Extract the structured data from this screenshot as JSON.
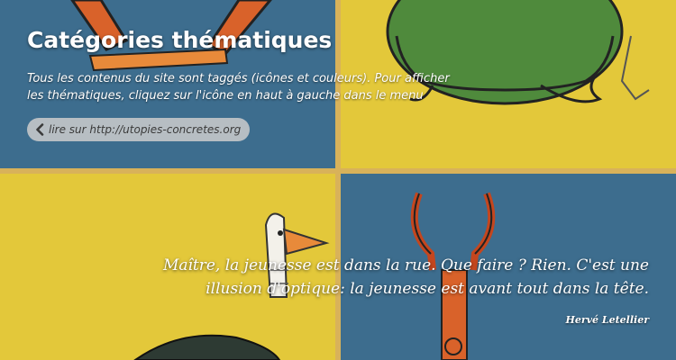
{
  "header": {
    "title": "Catégories thématiques",
    "description": "Tous les contenus du site sont taggés (icônes et couleurs). Pour afficher les thématiques, cliquez sur l'icône en haut à gauche dans le menu"
  },
  "link": {
    "label": "lire sur http://utopies-concretes.org",
    "icon": "chevron-left-icon"
  },
  "quote": {
    "text": "Maître, la jeunesse est dans la rue. Que faire ? Rien. C'est une illusion d'optique: la jeunesse est avant tout dans la tête.",
    "author": "Hervé Letellier"
  },
  "colors": {
    "blue_panel": "#3d6d8e",
    "yellow_panel": "#e3c83a",
    "green_creature": "#4f8a3c",
    "orange_accent": "#d9622a"
  }
}
